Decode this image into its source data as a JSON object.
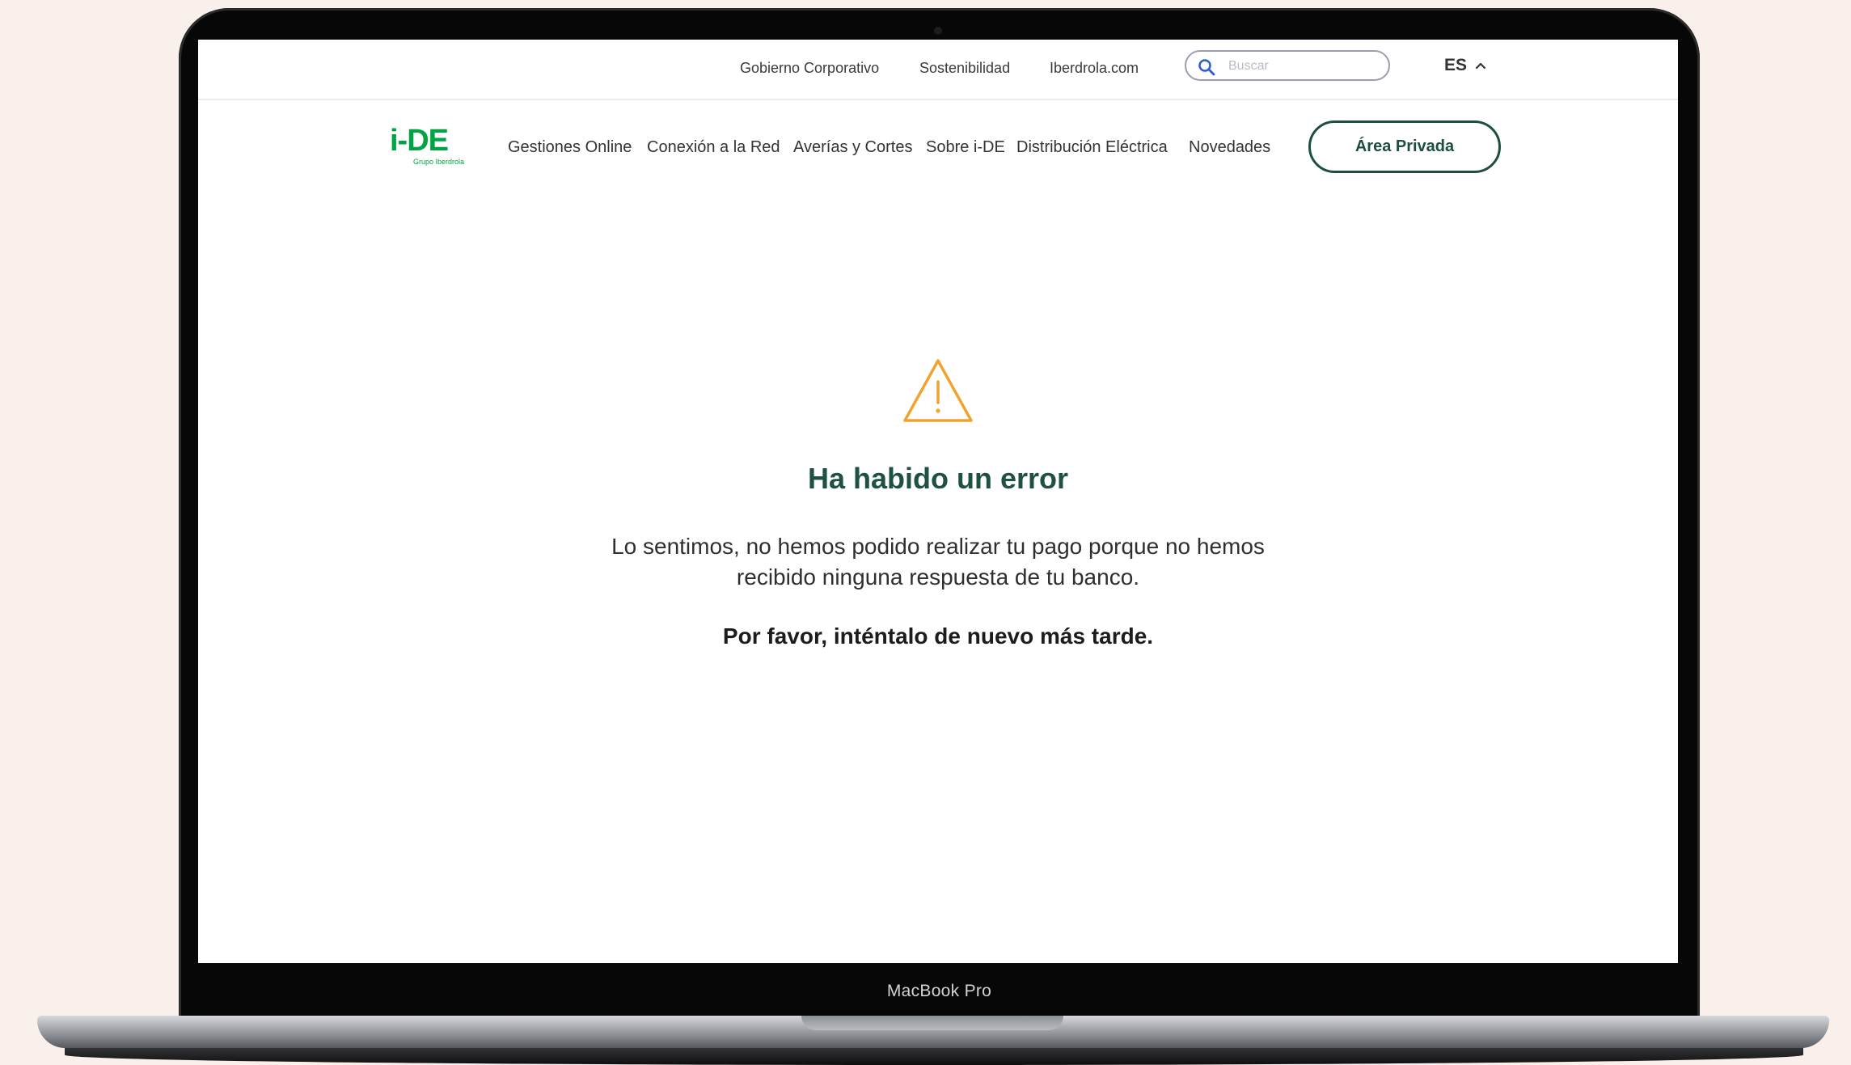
{
  "device": {
    "label": "MacBook Pro"
  },
  "topbar": {
    "links": [
      "Gobierno Corporativo",
      "Sostenibilidad",
      "Iberdrola.com"
    ],
    "search_placeholder": "Buscar",
    "language": "ES"
  },
  "header": {
    "logo_text": "i-DE",
    "logo_subtitle": "Grupo Iberdrola",
    "nav_items": [
      "Gestiones Online",
      "Conexión a la Red",
      "Averías y Cortes",
      "Sobre i-DE",
      "Distribución Eléctrica",
      "Novedades"
    ],
    "private_area_label": "Área Privada"
  },
  "error": {
    "icon": "warning-triangle-icon",
    "title": "Ha habido un error",
    "message": "Lo sentimos, no hemos podido realizar tu pago porque no hemos recibido ninguna respuesta de tu banco.",
    "call_to_action": "Por favor, inténtalo de nuevo más tarde."
  },
  "colors": {
    "brand_green": "#00a443",
    "dark_green": "#1d4f3e",
    "warning_orange": "#f0a32e",
    "backdrop": "#f9f0eb"
  }
}
